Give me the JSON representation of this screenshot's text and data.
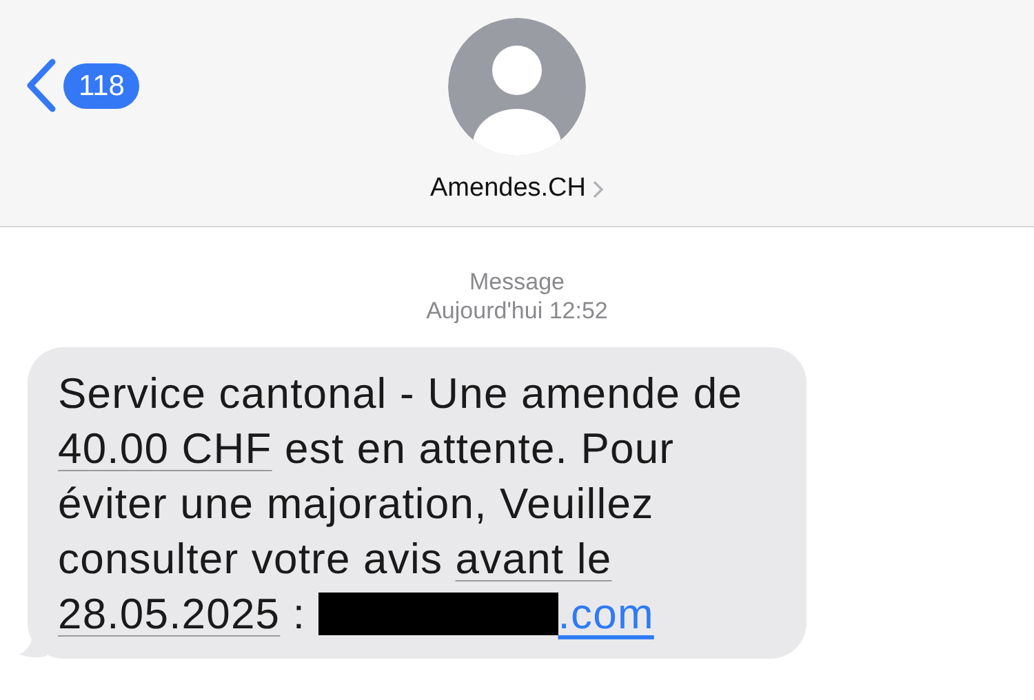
{
  "header": {
    "back_count": "118",
    "contact_name": "Amendes.CH"
  },
  "thread": {
    "service": "Message",
    "timestamp": "Aujourd'hui 12:52"
  },
  "message": {
    "segments": [
      {
        "kind": "text",
        "text": "Service cantonal - Une amende de "
      },
      {
        "kind": "detected",
        "text": "40.00 CHF"
      },
      {
        "kind": "text",
        "text": " est en attente. Pour éviter une majoration, Veuillez consulter votre avis "
      },
      {
        "kind": "detected",
        "text": "avant le 28.05.2025"
      },
      {
        "kind": "text",
        "text": " : "
      },
      {
        "kind": "redacted"
      },
      {
        "kind": "link",
        "text": ".com"
      }
    ]
  }
}
